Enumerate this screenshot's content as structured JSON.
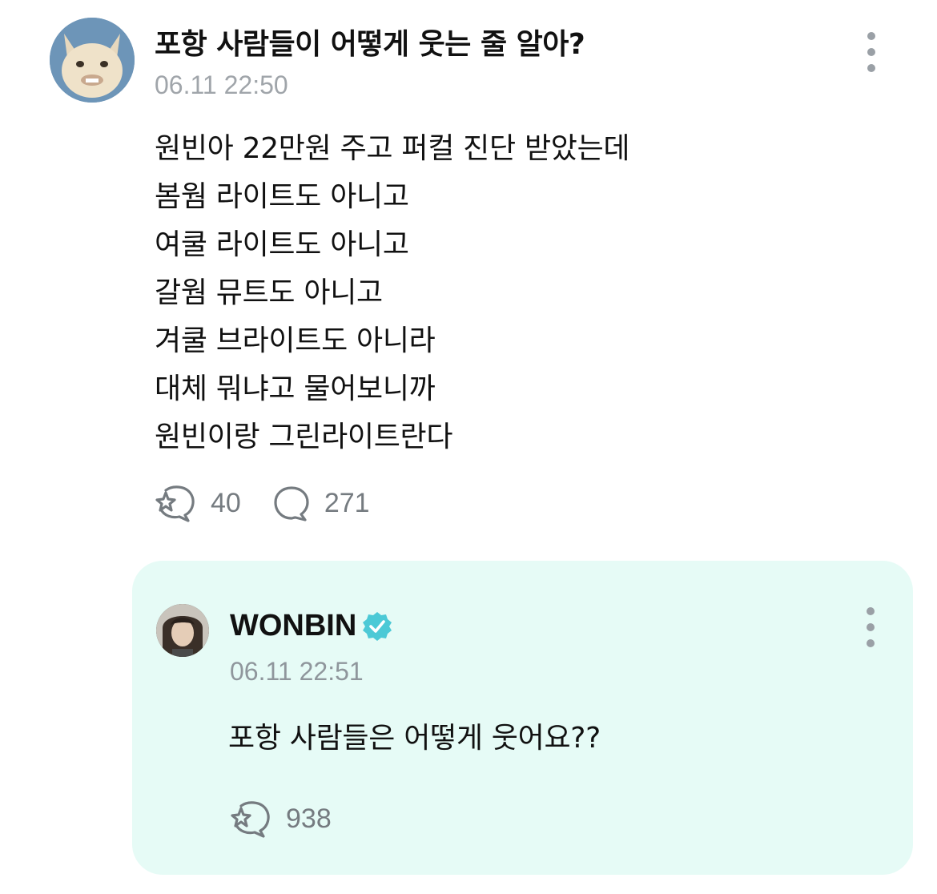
{
  "post": {
    "title": "포항 사람들이 어떻게 웃는 줄 알아?",
    "timestamp": "06.11 22:50",
    "body_lines": [
      "원빈아 22만원 주고 퍼컬 진단 받았는데",
      "봄웜 라이트도 아니고",
      "여쿨 라이트도 아니고",
      "갈웜 뮤트도 아니고",
      "겨쿨 브라이트도 아니라",
      "대체 뭐냐고 물어보니까",
      "원빈이랑 그린라이트란다"
    ],
    "like_count": "40",
    "comment_count": "271",
    "icons": {
      "like": "sparkle-bubble-icon",
      "comment": "speech-bubble-icon",
      "more": "more-vertical-icon"
    }
  },
  "reply": {
    "author": "WONBIN",
    "timestamp": "06.11 22:51",
    "body": "포항 사람들은 어떻게 웃어요??",
    "like_count": "938",
    "icons": {
      "verified": "verified-badge-icon",
      "like": "sparkle-bubble-icon",
      "more": "more-vertical-icon"
    }
  },
  "colors": {
    "reply_background": "#e6fbf6",
    "verified_badge": "#4cc9d6",
    "meta_text": "#a0a5aa",
    "icon": "#757b80"
  }
}
